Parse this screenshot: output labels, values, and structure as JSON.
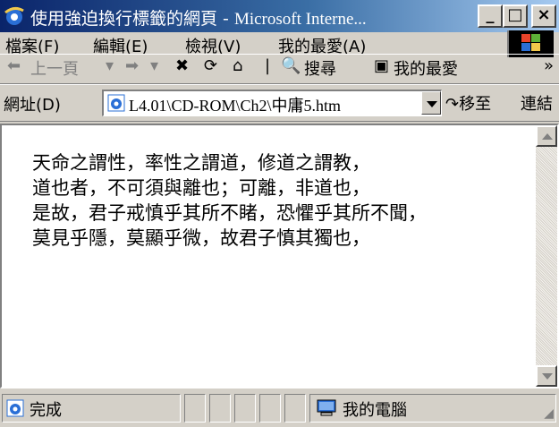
{
  "window": {
    "title_zh": "使用強迫換行標籤的網頁 - ",
    "title_en": "Microsoft Interne...",
    "minimize": "_",
    "maximize": "□",
    "close": "×"
  },
  "menu": {
    "items": [
      "檔案(F)",
      "編輯(E)",
      "檢視(V)",
      "我的最愛(A)"
    ]
  },
  "toolbar": {
    "back": "上一頁",
    "search": "搜尋",
    "favorites": "我的最愛",
    "more": "»"
  },
  "address": {
    "label": "網址(D)",
    "value": "L4.01\\CD-ROM\\Ch2\\中庸5.htm",
    "go": "移至",
    "links": "連結 »"
  },
  "content": {
    "lines": [
      "天命之謂性，率性之謂道，修道之謂教，",
      "道也者，不可須與離也；可離，非道也，",
      "是故，君子戒慎乎其所不睹，恐懼乎其所不聞，",
      "莫見乎隱，莫顯乎微，故君子慎其獨也，"
    ]
  },
  "status": {
    "text": "完成",
    "zone": "我的電腦"
  },
  "colors": {
    "titlebar_start": "#0a246a",
    "titlebar_end": "#a6caf0",
    "chrome": "#d4d0c8"
  }
}
